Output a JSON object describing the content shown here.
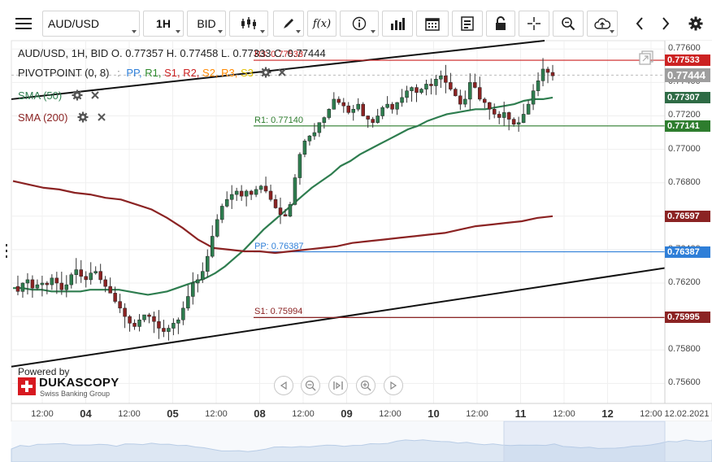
{
  "toolbar": {
    "symbol": "AUD/USD",
    "timeframe": "1H",
    "price_side": "BID",
    "fx_label": "f(x)"
  },
  "legend": {
    "ohlc_line": "AUD/USD, 1H, BID    O. 0.77357 H. 0.77458 L. 0.77333 C. 0.77444",
    "pivot_name": "PIVOTPOINT (0, 8)",
    "pivot_sep": ":",
    "pivot_items": [
      {
        "label": "PP,",
        "color": "#2f7fd8"
      },
      {
        "label": "R1,",
        "color": "#2e8b2e"
      },
      {
        "label": "S1,",
        "color": "#cc2222"
      },
      {
        "label": "R2,",
        "color": "#cc2222"
      },
      {
        "label": "S2,",
        "color": "#ff8800"
      },
      {
        "label": "R3,",
        "color": "#ff8800"
      },
      {
        "label": "S3",
        "color": "#e0c000"
      }
    ],
    "sma50": "SMA (50)",
    "sma200": "SMA (200)"
  },
  "branding": {
    "powered_by": "Powered by",
    "name": "DUKASCOPY",
    "tagline": "Swiss Banking Group"
  },
  "chart_data": {
    "type": "candlestick",
    "instrument": "AUD/USD",
    "timeframe": "1H",
    "ylim": [
      0.7548,
      0.7765
    ],
    "y_ticks": [
      "0.77600",
      "0.77400",
      "0.77200",
      "0.77000",
      "0.76800",
      "0.76600",
      "0.76400",
      "0.76200",
      "0.76000",
      "0.75800",
      "0.75600"
    ],
    "x_ticks": [
      {
        "label": "12:00",
        "bold": false
      },
      {
        "label": "04",
        "bold": true
      },
      {
        "label": "12:00",
        "bold": false
      },
      {
        "label": "05",
        "bold": true
      },
      {
        "label": "12:00",
        "bold": false
      },
      {
        "label": "08",
        "bold": true
      },
      {
        "label": "12:00",
        "bold": false
      },
      {
        "label": "09",
        "bold": true
      },
      {
        "label": "12:00",
        "bold": false
      },
      {
        "label": "10",
        "bold": true
      },
      {
        "label": "12:00",
        "bold": false
      },
      {
        "label": "11",
        "bold": true
      },
      {
        "label": "12:00",
        "bold": false
      },
      {
        "label": "12",
        "bold": true
      },
      {
        "label": "12:00",
        "bold": false
      },
      {
        "label": "12.02.2021",
        "bold": false
      }
    ],
    "close_path": [
      0.7618,
      0.7615,
      0.762,
      0.7622,
      0.7617,
      0.7619,
      0.762,
      0.7619,
      0.7623,
      0.762,
      0.7616,
      0.7619,
      0.7625,
      0.7628,
      0.7624,
      0.7622,
      0.7626,
      0.7627,
      0.7622,
      0.7618,
      0.7614,
      0.7609,
      0.7605,
      0.76,
      0.7596,
      0.7594,
      0.7598,
      0.7601,
      0.76,
      0.7597,
      0.7593,
      0.7591,
      0.7593,
      0.7596,
      0.7598,
      0.7605,
      0.7612,
      0.762,
      0.7622,
      0.7627,
      0.7636,
      0.7648,
      0.7658,
      0.7666,
      0.767,
      0.7673,
      0.7675,
      0.7672,
      0.7675,
      0.7673,
      0.7676,
      0.7678,
      0.7675,
      0.767,
      0.7665,
      0.7661,
      0.766,
      0.7667,
      0.7683,
      0.7697,
      0.7705,
      0.7708,
      0.771,
      0.7716,
      0.7719,
      0.7724,
      0.773,
      0.7728,
      0.7726,
      0.7722,
      0.7724,
      0.7727,
      0.772,
      0.7718,
      0.7716,
      0.772,
      0.7725,
      0.7727,
      0.7724,
      0.7728,
      0.7731,
      0.7735,
      0.7737,
      0.7734,
      0.7736,
      0.7739,
      0.7738,
      0.7742,
      0.7744,
      0.774,
      0.7736,
      0.7732,
      0.7727,
      0.773,
      0.774,
      0.7737,
      0.773,
      0.7728,
      0.7724,
      0.7721,
      0.7719,
      0.7722,
      0.7718,
      0.7715,
      0.7716,
      0.7721,
      0.7727,
      0.7735,
      0.7741,
      0.7748,
      0.7746,
      0.7744
    ],
    "series": [
      {
        "name": "SMA (50)",
        "color": "#2e7d4f",
        "values": [
          0.7617,
          0.7617,
          0.7616,
          0.7616,
          0.7615,
          0.7615,
          0.7615,
          0.7615,
          0.7616,
          0.7616,
          0.7616,
          0.7616,
          0.7615,
          0.7614,
          0.7613,
          0.7614,
          0.7615,
          0.7617,
          0.7619,
          0.7621,
          0.7623,
          0.7626,
          0.763,
          0.7635,
          0.764,
          0.7646,
          0.7652,
          0.7657,
          0.7662,
          0.7667,
          0.7672,
          0.7677,
          0.7681,
          0.7685,
          0.769,
          0.7693,
          0.7697,
          0.77,
          0.7703,
          0.7706,
          0.7709,
          0.7712,
          0.7714,
          0.7717,
          0.7719,
          0.7721,
          0.7722,
          0.7723,
          0.7724,
          0.7724,
          0.7725,
          0.7726,
          0.7727,
          0.7729,
          0.773,
          0.773,
          0.7731
        ]
      },
      {
        "name": "SMA (200)",
        "color": "#8b2323",
        "values": [
          0.7681,
          0.7679,
          0.7677,
          0.7676,
          0.7674,
          0.7673,
          0.7671,
          0.767,
          0.7667,
          0.7664,
          0.7659,
          0.7653,
          0.7646,
          0.7641,
          0.764,
          0.7639,
          0.7639,
          0.7638,
          0.7639,
          0.764,
          0.7641,
          0.7642,
          0.7644,
          0.7645,
          0.7646,
          0.7647,
          0.7648,
          0.7649,
          0.765,
          0.7652,
          0.7654,
          0.7655,
          0.7656,
          0.7657,
          0.7659,
          0.766
        ]
      }
    ],
    "pivots": [
      {
        "name": "R3",
        "label": "R3: 0.77533",
        "value": 0.77533,
        "color": "#cc2222"
      },
      {
        "name": "R1",
        "label": "R1: 0.77140",
        "value": 0.7714,
        "color": "#2e7d2e"
      },
      {
        "name": "PP",
        "label": "PP: 0.76387",
        "value": 0.76387,
        "color": "#2f7fd8"
      },
      {
        "name": "S1",
        "label": "S1: 0.75994",
        "value": 0.75994,
        "color": "#8b2323"
      }
    ],
    "price_tags": [
      {
        "text": "0.77533",
        "value": 0.77533,
        "color": "#cc2222"
      },
      {
        "text": "0.77444",
        "value": 0.77444,
        "color": "#9e9e9e"
      },
      {
        "text": "0.77307",
        "value": 0.77307,
        "color": "#2e6b45"
      },
      {
        "text": "0.77141",
        "value": 0.77141,
        "color": "#2e7d2e"
      },
      {
        "text": "0.76597",
        "value": 0.76597,
        "color": "#8b2323"
      },
      {
        "text": "0.76387",
        "value": 0.76387,
        "color": "#2f7fd8"
      },
      {
        "text": "0.75995",
        "value": 0.75995,
        "color": "#8b2323"
      }
    ],
    "trendlines": [
      {
        "name": "upper",
        "from": 0.773,
        "to": 0.7766
      },
      {
        "name": "lower",
        "from": 0.757,
        "to": 0.7629
      }
    ],
    "last_close": 0.77444
  }
}
